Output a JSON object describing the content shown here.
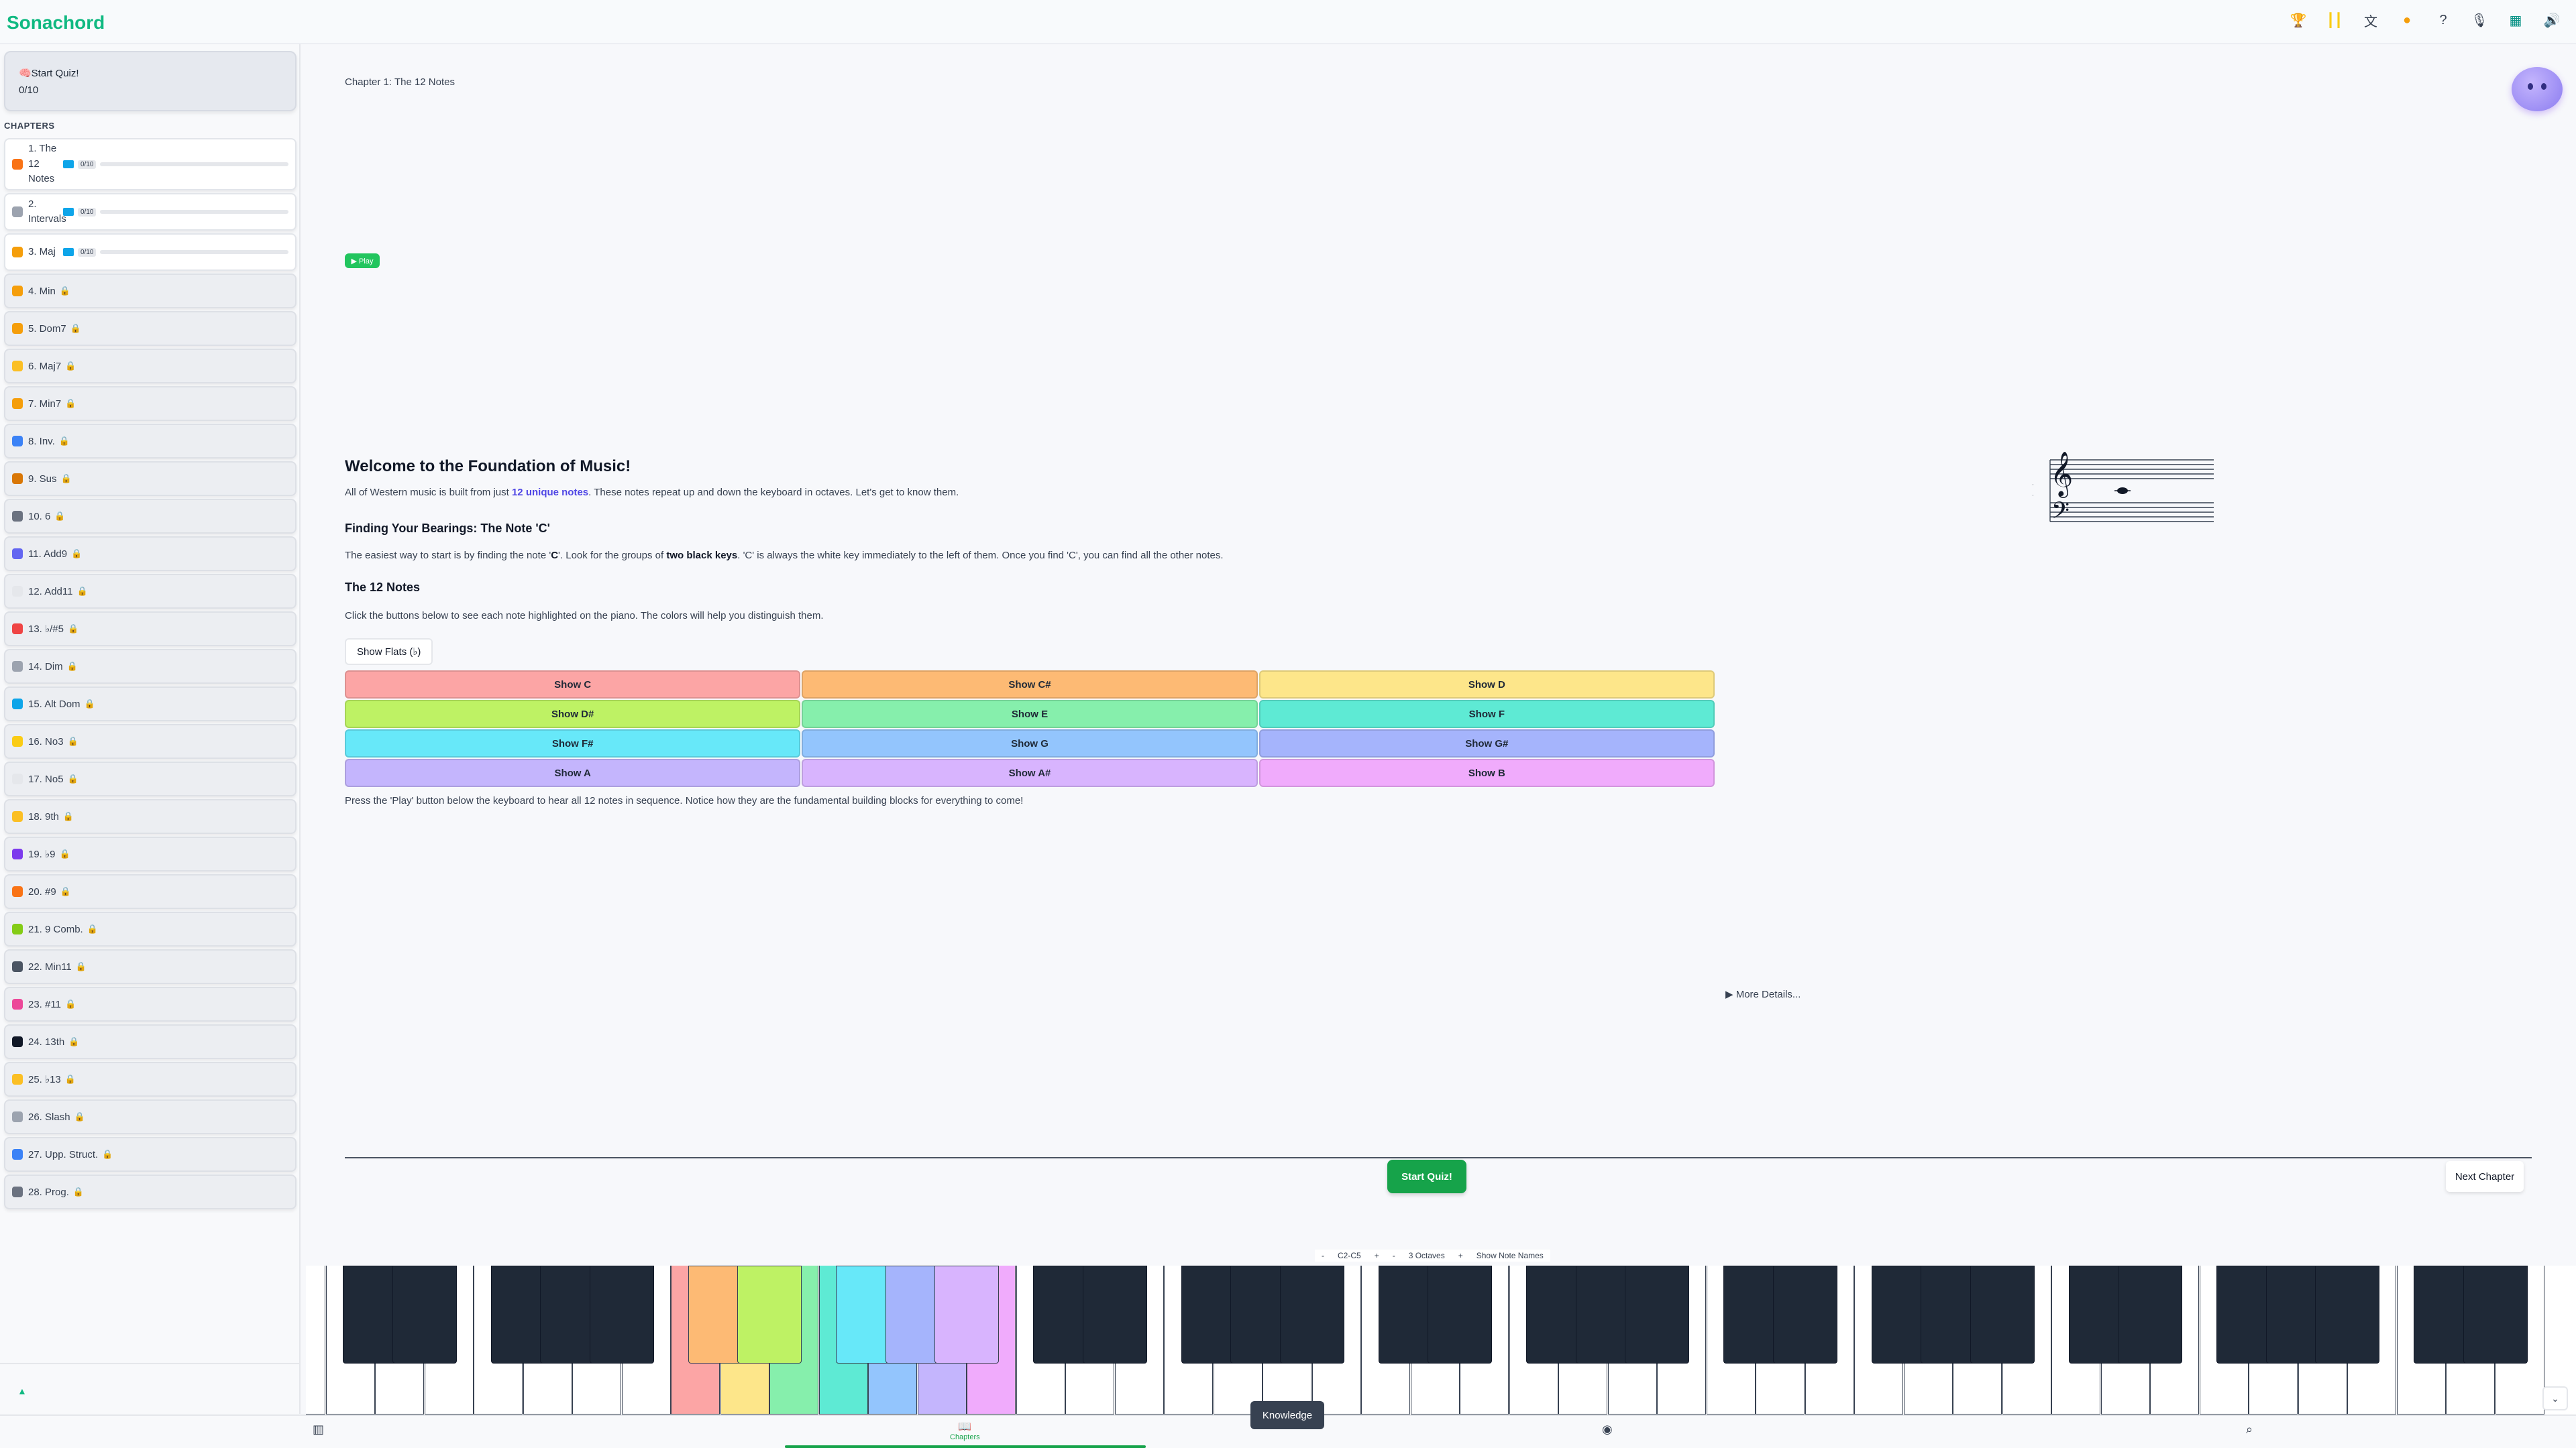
{
  "app": {
    "title": "Sonachord"
  },
  "topbar": {
    "icons": [
      "trophy-icon",
      "streak-bars-icon",
      "translate-icon",
      "coin-icon",
      "help-icon",
      "mic-icon",
      "layout-icon",
      "volume-icon"
    ]
  },
  "sidebar": {
    "quiz": {
      "label": "🧠Start Quiz!",
      "progress": "0/10"
    },
    "chapters_heading": "CHAPTERS",
    "chapters": [
      {
        "label": "1. The 12 Notes",
        "icon": "grid-icon",
        "color": "#f97316",
        "open": true,
        "progress": "0/10"
      },
      {
        "label": "2. Intervals",
        "icon": "ruler-icon",
        "color": "#9ca3af",
        "open": true,
        "progress": "0/10"
      },
      {
        "label": "3. Maj",
        "icon": "smile-icon",
        "color": "#f59e0b",
        "open": true,
        "progress": "0/10"
      },
      {
        "label": "4. Min",
        "icon": "sad-icon",
        "color": "#f59e0b",
        "lock": "🔒"
      },
      {
        "label": "5. Dom7",
        "icon": "face-icon",
        "color": "#f59e0b",
        "lock": "🔒"
      },
      {
        "label": "6. Maj7",
        "icon": "sparkle-icon",
        "color": "#fbbf24",
        "lock": "🔒"
      },
      {
        "label": "7. Min7",
        "icon": "moon-icon",
        "color": "#f59e0b",
        "lock": "🔒"
      },
      {
        "label": "8. Inv.",
        "icon": "arrows-icon",
        "color": "#3b82f6",
        "lock": "🔒"
      },
      {
        "label": "9. Sus",
        "icon": "hourglass-icon",
        "color": "#d97706",
        "lock": "🔒"
      },
      {
        "label": "10. 6",
        "icon": "dice-icon",
        "color": "#6b7280",
        "lock": "🔒"
      },
      {
        "label": "11. Add9",
        "icon": "plus-icon",
        "color": "#6366f1",
        "lock": "🔒"
      },
      {
        "label": "12. Add11",
        "icon": "circle-icon",
        "color": "#e5e7eb",
        "lock": "🔒"
      },
      {
        "label": "13. ♭/#5",
        "icon": "pepper-icon",
        "color": "#ef4444",
        "lock": "🔒"
      },
      {
        "label": "14. Dim",
        "icon": "dim-icon",
        "color": "#9ca3af",
        "lock": "🔒"
      },
      {
        "label": "15. Alt Dom",
        "icon": "alt-icon",
        "color": "#0ea5e9",
        "lock": "🔒"
      },
      {
        "label": "16. No3",
        "icon": "hand-icon",
        "color": "#facc15",
        "lock": "🔒"
      },
      {
        "label": "17. No5",
        "icon": "circle-icon",
        "color": "#e5e7eb",
        "lock": "🔒"
      },
      {
        "label": "18. 9th",
        "icon": "sparkle-icon",
        "color": "#fbbf24",
        "lock": "🔒"
      },
      {
        "label": "19. ♭9",
        "icon": "mask-icon",
        "color": "#7c3aed",
        "lock": "🔒"
      },
      {
        "label": "20. #9",
        "icon": "flame-icon",
        "color": "#f97316",
        "lock": "🔒"
      },
      {
        "label": "21. 9 Comb.",
        "icon": "leaf-icon",
        "color": "#84cc16",
        "lock": "🔒"
      },
      {
        "label": "22. Min11",
        "icon": "film-icon",
        "color": "#4b5563",
        "lock": "🔒"
      },
      {
        "label": "23. #11",
        "icon": "rainbow-icon",
        "color": "#ec4899",
        "lock": "🔒"
      },
      {
        "label": "24. 13th",
        "icon": "keys-icon",
        "color": "#111827",
        "lock": "🔒"
      },
      {
        "label": "25. ♭13",
        "icon": "moon-icon",
        "color": "#fbbf24",
        "lock": "🔒"
      },
      {
        "label": "26. Slash",
        "icon": "link-icon",
        "color": "#9ca3af",
        "lock": "🔒"
      },
      {
        "label": "27. Upp. Struct.",
        "icon": "layers-icon",
        "color": "#3b82f6",
        "lock": "🔒"
      },
      {
        "label": "28. Prog.",
        "icon": "gear-icon",
        "color": "#6b7280",
        "lock": "🔒"
      }
    ],
    "footer_icon": "▲"
  },
  "main": {
    "breadcrumb": "Chapter 1: The 12 Notes",
    "play_label": "▶ Play",
    "welcome_title": "Welcome to the Foundation of Music!",
    "p1_a": "All of Western music is built from just ",
    "p1_b": "12 unique notes",
    "p1_c": ". These notes repeat up and down the keyboard in octaves. Let's get to know them.",
    "finding_title": "Finding Your Bearings: The Note 'C'",
    "p2_a": "The easiest way to start is by finding the note '",
    "p2_b": "C",
    "p2_c": "'. Look for the groups of ",
    "p2_d": "two black keys",
    "p2_e": ". 'C' is always the white key immediately to the left of them. Once you find 'C', you can find all the other notes.",
    "notes_title": "The 12 Notes",
    "p3": "Click the buttons below to see each note highlighted on the piano. The colors will help you distinguish them.",
    "flats_label": "Show Flats (♭)",
    "note_buttons": [
      {
        "label": "Show C",
        "color": "#fca5a5"
      },
      {
        "label": "Show C#",
        "color": "#fdba74"
      },
      {
        "label": "Show D",
        "color": "#fde68a"
      },
      {
        "label": "Show D#",
        "color": "#bef264"
      },
      {
        "label": "Show E",
        "color": "#86efac"
      },
      {
        "label": "Show F",
        "color": "#5eead4"
      },
      {
        "label": "Show F#",
        "color": "#67e8f9"
      },
      {
        "label": "Show G",
        "color": "#93c5fd"
      },
      {
        "label": "Show G#",
        "color": "#a5b4fc"
      },
      {
        "label": "Show A",
        "color": "#c4b5fd"
      },
      {
        "label": "Show A#",
        "color": "#d8b4fe"
      },
      {
        "label": "Show B",
        "color": "#f0abfc"
      }
    ],
    "p4": "Press the 'Play' button below the keyboard to hear all 12 notes in sequence. Notice how they are the fundamental building blocks for everything to come!",
    "more_details": "▶ More Details...",
    "start_quiz": "Start Quiz!",
    "next_chapter": "Next Chapter"
  },
  "piano": {
    "range_minus": "-",
    "range": "C2-C5",
    "range_plus": "+",
    "oct_minus": "-",
    "octaves": "3 Octaves",
    "oct_plus": "+",
    "show_names": "Show Note Names",
    "scroll_icon": "⌄"
  },
  "bottomnav": {
    "chapters_label": "Chapters",
    "tooltip": "Knowledge"
  }
}
